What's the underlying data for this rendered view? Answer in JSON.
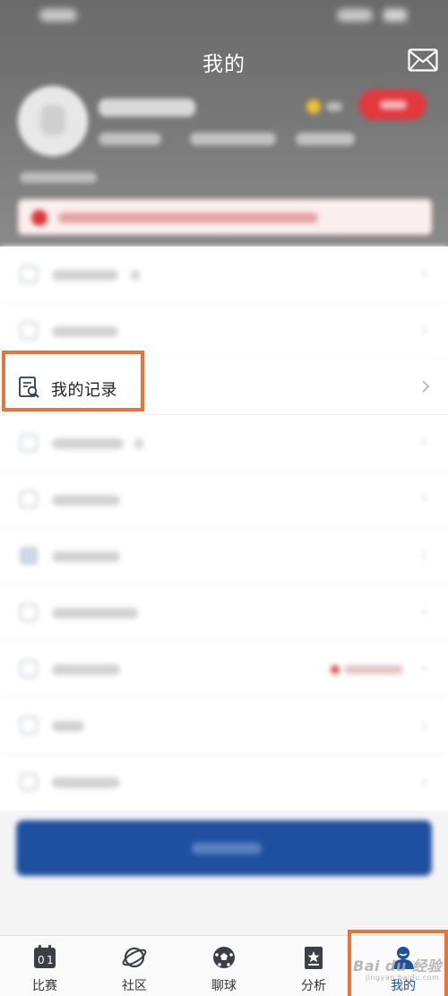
{
  "header": {
    "title": "我的",
    "background_color": "#777777"
  },
  "menu": {
    "highlighted_item_label": "我的记录"
  },
  "tabbar": {
    "active_color": "#1f50a0",
    "items": [
      {
        "label": "比赛",
        "icon": "scoreboard-icon"
      },
      {
        "label": "社区",
        "icon": "planet-icon"
      },
      {
        "label": "聊球",
        "icon": "soccer-ball-icon"
      },
      {
        "label": "分析",
        "icon": "star-document-icon"
      },
      {
        "label": "我的",
        "icon": "user-icon"
      }
    ]
  },
  "annotation": {
    "highlight_color": "#e8743b"
  },
  "watermark": {
    "brand": "Bai du 经验",
    "url": "jingyan.baidu.com"
  }
}
